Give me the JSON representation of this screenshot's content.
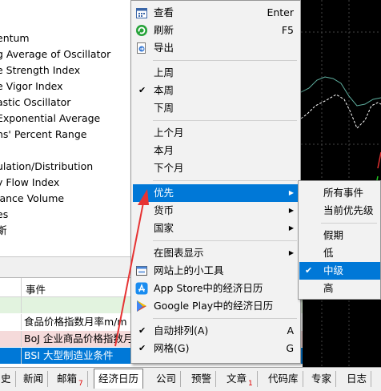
{
  "indicators": [
    "entum",
    "g Average of Oscillator",
    "e Strength Index",
    "e Vigor Index",
    "astic Oscillator",
    " Exponential Average",
    "ns' Percent Range",
    "",
    "ulation/Distribution",
    "y Flow Index",
    "lance Volume",
    "es",
    "斯"
  ],
  "calendar": {
    "header_event": "事件",
    "rows": [
      {
        "event": "",
        "bg": "#e2f3df"
      },
      {
        "event": "食品价格指数月率m/m",
        "bg": "#ffffff"
      },
      {
        "event": "BoJ 企业商品价格指数月",
        "bg": "#f5dada"
      },
      {
        "event": "BSI 大型制造业条件",
        "bg": "#0078d7",
        "selected": true
      }
    ]
  },
  "tabs": [
    {
      "label": "史"
    },
    {
      "label": "新闻"
    },
    {
      "label": "邮箱",
      "badge": "7"
    },
    {
      "label": "经济日历",
      "active": true
    },
    {
      "label": "公司"
    },
    {
      "label": "预警"
    },
    {
      "label": "文章",
      "badge": "1"
    },
    {
      "label": "代码库"
    },
    {
      "label": "专家"
    },
    {
      "label": "日志"
    }
  ],
  "menu": {
    "view": {
      "label": "查看",
      "shortcut": "Enter",
      "icon": "calendar-icon"
    },
    "refresh": {
      "label": "刷新",
      "shortcut": "F5",
      "icon": "refresh-icon"
    },
    "export": {
      "label": "导出",
      "icon": "export-icon"
    },
    "last_week": {
      "label": "上周"
    },
    "this_week": {
      "label": "本周",
      "checked": true
    },
    "next_week": {
      "label": "下周"
    },
    "last_month": {
      "label": "上个月"
    },
    "this_month": {
      "label": "本月"
    },
    "next_month": {
      "label": "下个月"
    },
    "priority": {
      "label": "优先",
      "highlighted": true
    },
    "currency": {
      "label": "货币"
    },
    "country": {
      "label": "国家"
    },
    "show_on_chart": {
      "label": "在图表显示"
    },
    "web_widget": {
      "label": "网站上的小工具",
      "icon": "widget-icon"
    },
    "app_store": {
      "label": "App Store中的经济日历",
      "icon": "app-store-icon"
    },
    "google_play": {
      "label": "Google Play中的经济日历",
      "icon": "google-play-icon"
    },
    "auto_arrange": {
      "label": "自动排列(A)",
      "shortcut": "A",
      "checked": true
    },
    "grid": {
      "label": "网格(G)",
      "shortcut": "G",
      "checked": true
    }
  },
  "submenu": {
    "all_events": "所有事件",
    "current_priority": "当前优先级",
    "holiday": "假期",
    "low": "低",
    "medium": "中级",
    "high": "高",
    "selected": "medium"
  },
  "colors": {
    "highlight": "#0078d7",
    "arrow": "#e63333",
    "chart_bg": "#000000"
  }
}
